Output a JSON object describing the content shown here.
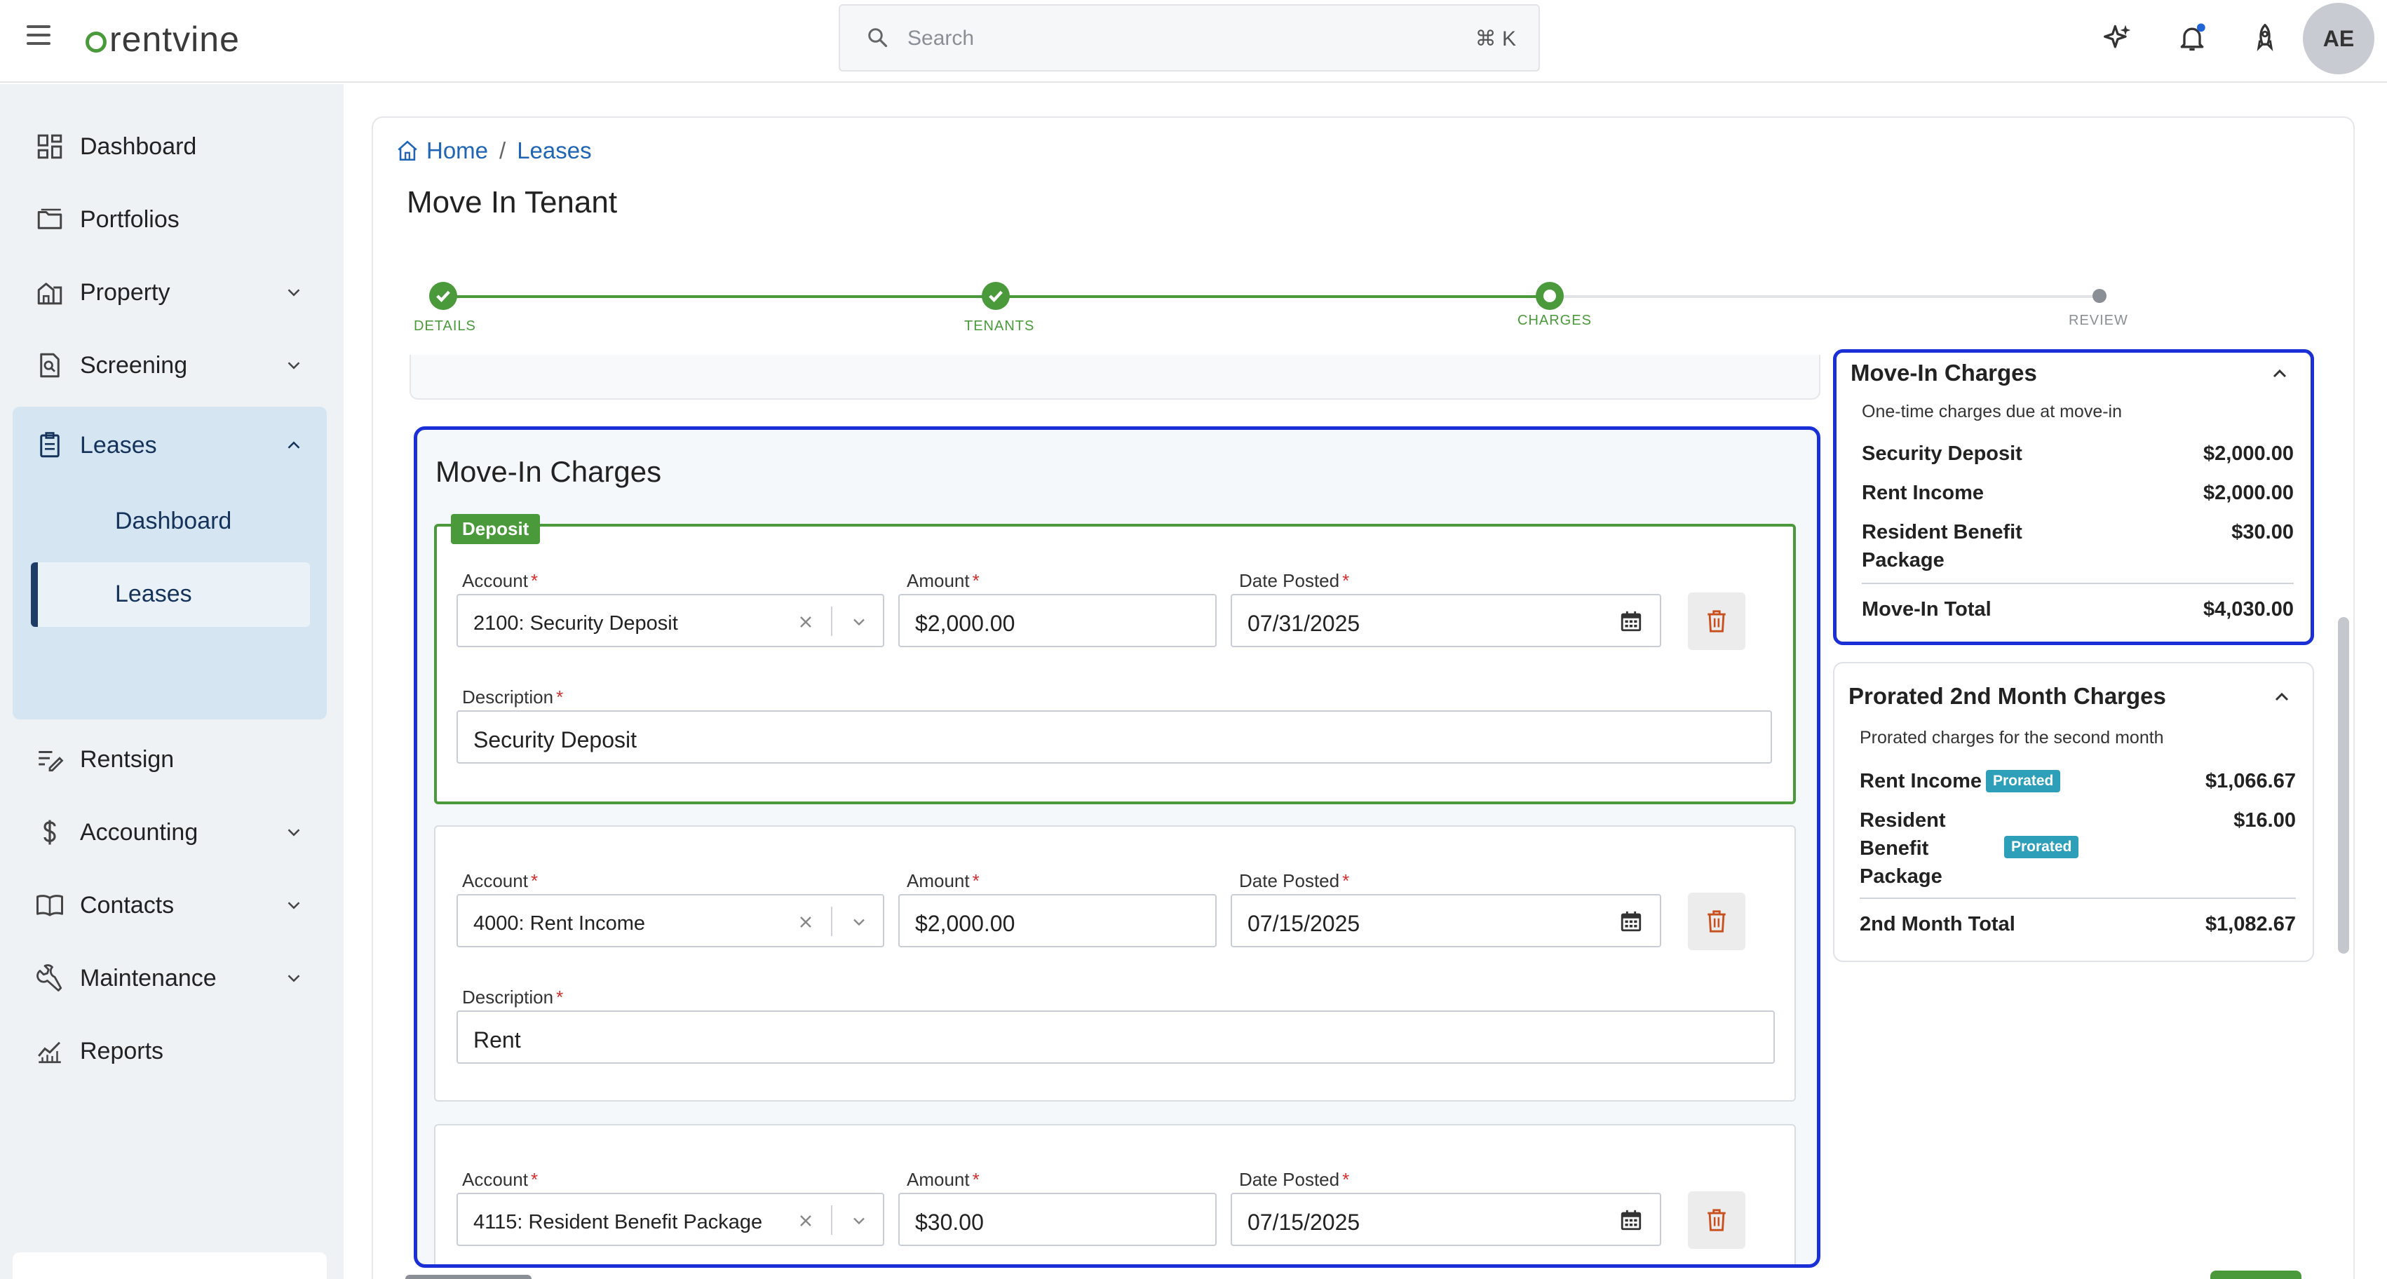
{
  "app": {
    "brand": "rentvine",
    "search_placeholder": "Search",
    "search_shortcut": "⌘ K",
    "avatar_initials": "AE",
    "accent": "#4a9a3b",
    "highlight": "#1a2fd6",
    "icons": [
      "menu-icon",
      "search-icon",
      "sparkle-icon",
      "bell-icon",
      "rocket-icon"
    ]
  },
  "sidebar": {
    "items": [
      {
        "label": "Dashboard",
        "icon": "dashboard-icon"
      },
      {
        "label": "Portfolios",
        "icon": "folder-icon"
      },
      {
        "label": "Property",
        "icon": "property-icon"
      },
      {
        "label": "Screening",
        "icon": "screening-icon"
      },
      {
        "label": "Leases",
        "icon": "leases-icon"
      },
      {
        "label": "Rentsign",
        "icon": "sign-icon"
      },
      {
        "label": "Accounting",
        "icon": "dollar-icon"
      },
      {
        "label": "Contacts",
        "icon": "book-icon"
      },
      {
        "label": "Maintenance",
        "icon": "wrench-icon"
      },
      {
        "label": "Reports",
        "icon": "chart-icon"
      }
    ],
    "leases_sub": [
      "Dashboard",
      "Leases"
    ]
  },
  "breadcrumb": {
    "home": "Home",
    "sep": "/",
    "current": "Leases"
  },
  "page_title": "Move In Tenant",
  "stepper": {
    "steps": [
      "DETAILS",
      "TENANTS",
      "CHARGES",
      "REVIEW"
    ],
    "current": 2
  },
  "charges": {
    "title": "Move-In Charges",
    "deposit_tag": "Deposit",
    "labels": {
      "account": "Account",
      "amount": "Amount",
      "date": "Date Posted",
      "description": "Description",
      "required": "*"
    },
    "rows": [
      {
        "account": "2100: Security Deposit",
        "amount": "$2,000.00",
        "date": "07/31/2025",
        "description": "Security Deposit"
      },
      {
        "account": "4000: Rent Income",
        "amount": "$2,000.00",
        "date": "07/15/2025",
        "description": "Rent"
      },
      {
        "account": "4115: Resident Benefit Package",
        "amount": "$30.00",
        "date": "07/15/2025"
      }
    ]
  },
  "summary_movein": {
    "title": "Move-In Charges",
    "subtitle": "One-time charges due at move-in",
    "lines": [
      {
        "label": "Security Deposit",
        "value": "$2,000.00"
      },
      {
        "label": "Rent Income",
        "value": "$2,000.00"
      },
      {
        "label": "Resident Benefit Package",
        "value": "$30.00"
      }
    ],
    "total_label": "Move-In Total",
    "total_value": "$4,030.00"
  },
  "summary_prorated": {
    "title": "Prorated 2nd Month Charges",
    "subtitle": "Prorated charges for the second month",
    "badge": "Prorated",
    "lines": [
      {
        "label": "Rent Income",
        "value": "$1,066.67"
      },
      {
        "label": "Resident Benefit Package",
        "value": "$16.00"
      }
    ],
    "total_label": "2nd Month Total",
    "total_value": "$1,082.67"
  }
}
